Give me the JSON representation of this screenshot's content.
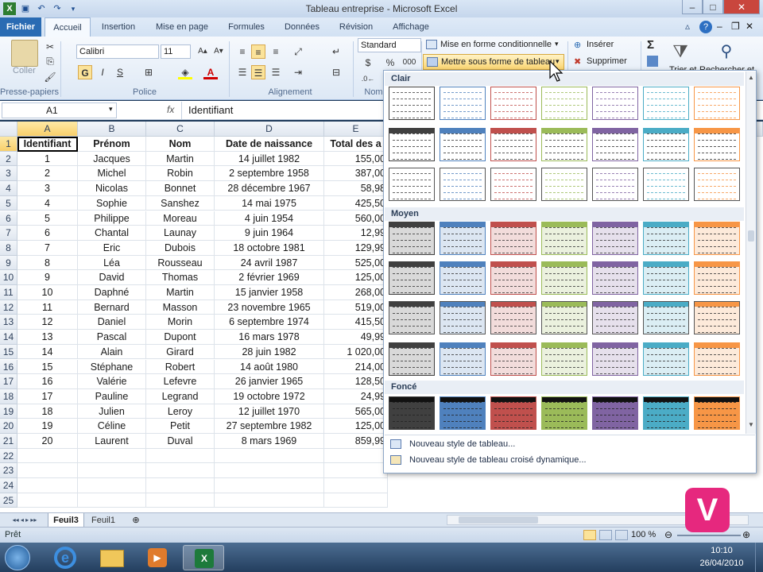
{
  "title": "Tableau entreprise  -  Microsoft Excel",
  "ribbon_tabs": [
    "Fichier",
    "Accueil",
    "Insertion",
    "Mise en page",
    "Formules",
    "Données",
    "Révision",
    "Affichage"
  ],
  "clipboard": {
    "paste_label": "Coller",
    "group": "Presse-papiers"
  },
  "font": {
    "name": "Calibri",
    "size": "11",
    "bold": "G",
    "italic": "I",
    "underline": "S",
    "group": "Police"
  },
  "alignment": {
    "group": "Alignement"
  },
  "number": {
    "format": "Standard",
    "group": "Nom",
    "percent": "%",
    "thousands": "000"
  },
  "styles": {
    "conditional": "Mise en forme conditionnelle",
    "table_format": "Mettre sous forme de tableau"
  },
  "cells_grp": {
    "insert": "Insérer",
    "delete": "Supprimer"
  },
  "editing": {
    "sigma": "Σ",
    "sort": "Trier et",
    "find": "Rechercher et"
  },
  "name_box": "A1",
  "fx": "fx",
  "formula_value": "Identifiant",
  "columns": [
    "A",
    "B",
    "C",
    "D",
    "E"
  ],
  "headers": [
    "Identifiant",
    "Prénom",
    "Nom",
    "Date de naissance",
    "Total des a"
  ],
  "rows": [
    [
      "1",
      "Jacques",
      "Martin",
      "14 juillet 1982",
      "155,00"
    ],
    [
      "2",
      "Michel",
      "Robin",
      "2 septembre 1958",
      "387,00"
    ],
    [
      "3",
      "Nicolas",
      "Bonnet",
      "28 décembre 1967",
      "58,98"
    ],
    [
      "4",
      "Sophie",
      "Sanshez",
      "14 mai 1975",
      "425,50"
    ],
    [
      "5",
      "Philippe",
      "Moreau",
      "4 juin 1954",
      "560,00"
    ],
    [
      "6",
      "Chantal",
      "Launay",
      "9 juin 1964",
      "12,99"
    ],
    [
      "7",
      "Eric",
      "Dubois",
      "18 octobre 1981",
      "129,99"
    ],
    [
      "8",
      "Léa",
      "Rousseau",
      "24 avril 1987",
      "525,00"
    ],
    [
      "9",
      "David",
      "Thomas",
      "2 février 1969",
      "125,00"
    ],
    [
      "10",
      "Daphné",
      "Martin",
      "15 janvier 1958",
      "268,00"
    ],
    [
      "11",
      "Bernard",
      "Masson",
      "23 novembre 1965",
      "519,00"
    ],
    [
      "12",
      "Daniel",
      "Morin",
      "6 septembre 1974",
      "415,50"
    ],
    [
      "13",
      "Pascal",
      "Dupont",
      "16 mars 1978",
      "49,99"
    ],
    [
      "14",
      "Alain",
      "Girard",
      "28 juin 1982",
      "1 020,00"
    ],
    [
      "15",
      "Stéphane",
      "Robert",
      "14 août 1980",
      "214,00"
    ],
    [
      "16",
      "Valérie",
      "Lefevre",
      "26 janvier 1965",
      "128,50"
    ],
    [
      "17",
      "Pauline",
      "Legrand",
      "19 octobre 1972",
      "24,99"
    ],
    [
      "18",
      "Julien",
      "Leroy",
      "12 juillet 1970",
      "565,00"
    ],
    [
      "19",
      "Céline",
      "Petit",
      "27 septembre 1982",
      "125,00"
    ],
    [
      "20",
      "Laurent",
      "Duval",
      "8 mars 1969",
      "859,99"
    ]
  ],
  "row_numbers": [
    "1",
    "2",
    "3",
    "4",
    "5",
    "6",
    "7",
    "8",
    "9",
    "10",
    "11",
    "12",
    "13",
    "14",
    "15",
    "16",
    "17",
    "18",
    "19",
    "20",
    "21",
    "22",
    "23",
    "24",
    "25"
  ],
  "gallery": {
    "sections": [
      "Clair",
      "Moyen",
      "Foncé"
    ],
    "colors": [
      "#404040",
      "#4f81bd",
      "#c0504d",
      "#9bbb59",
      "#8064a2",
      "#4bacc6",
      "#f79646"
    ],
    "menu": [
      "Nouveau style de tableau...",
      "Nouveau style de tableau croisé dynamique..."
    ]
  },
  "sheets": [
    "Feuil3",
    "Feuil1"
  ],
  "status": {
    "ready": "Prêt",
    "zoom": "100 %"
  },
  "taskbar": {
    "time": "10:10",
    "date": "26/04/2010"
  },
  "logo_letter": "V"
}
